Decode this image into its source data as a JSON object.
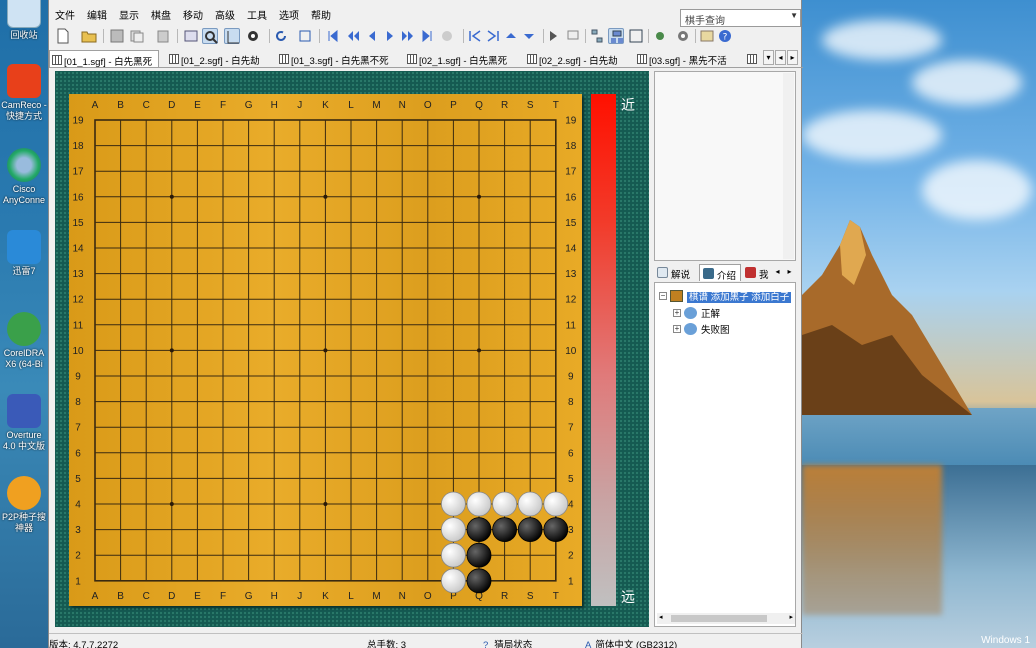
{
  "desktop": {
    "icons": [
      {
        "label": "回收站"
      },
      {
        "label": "CamReco - 快捷方式"
      },
      {
        "label": "Cisco AnyConne"
      },
      {
        "label": "迅雷7"
      },
      {
        "label": "CorelDRA X6 (64-Bi"
      },
      {
        "label": "Overture 4.0 中文版"
      },
      {
        "label": "P2P种子搜神器"
      }
    ],
    "windows_label": "Windows 1"
  },
  "menu": [
    "文件",
    "编辑",
    "显示",
    "棋盘",
    "移动",
    "高级",
    "工具",
    "选项",
    "帮助"
  ],
  "search": {
    "value": "棋手查询"
  },
  "tabs": [
    {
      "label": "[01_1.sgf] - 白先黑死",
      "active": true
    },
    {
      "label": "[01_2.sgf] - 白先劫"
    },
    {
      "label": "[01_3.sgf] - 白先黑不死"
    },
    {
      "label": "[02_1.sgf] - 白先黑死"
    },
    {
      "label": "[02_2.sgf] - 白先劫"
    },
    {
      "label": "[03.sgf] - 黑先不活"
    }
  ],
  "board": {
    "columns": [
      "A",
      "B",
      "C",
      "D",
      "E",
      "F",
      "G",
      "H",
      "J",
      "K",
      "L",
      "M",
      "N",
      "O",
      "P",
      "Q",
      "R",
      "S",
      "T"
    ],
    "rows": [
      "19",
      "18",
      "17",
      "16",
      "15",
      "14",
      "13",
      "12",
      "11",
      "10",
      "9",
      "8",
      "7",
      "6",
      "5",
      "4",
      "3",
      "2",
      "1"
    ],
    "stones": {
      "white": [
        "P4",
        "Q4",
        "R4",
        "S4",
        "T4",
        "P3",
        "P2",
        "P1"
      ],
      "black": [
        "Q3",
        "R3",
        "S3",
        "T3",
        "Q2",
        "Q1"
      ]
    },
    "heat_near": "近",
    "heat_far": "远"
  },
  "panel": {
    "tabs": [
      {
        "label": "解说"
      },
      {
        "label": "介绍",
        "active": true
      },
      {
        "label": "我"
      }
    ],
    "tree": {
      "root": "棋谱  添加黑子  添加白子",
      "children": [
        "正解",
        "失败图"
      ]
    }
  },
  "status": {
    "version": "版本: 4.7.7.2272",
    "moves": "总手数: 3",
    "mode": "猜局状态",
    "encoding": "简体中文 (GB2312)"
  }
}
